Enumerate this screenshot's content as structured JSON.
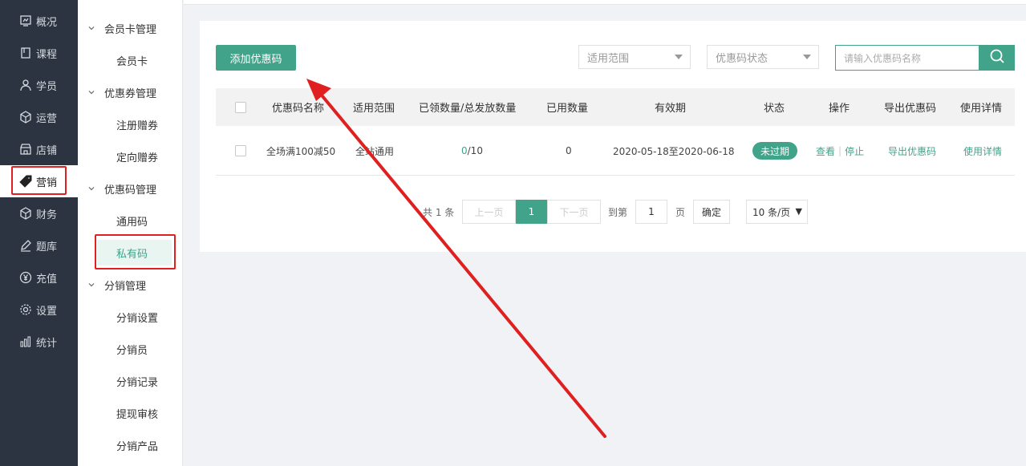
{
  "nav": {
    "items": [
      {
        "label": "概况",
        "icon": "dashboard-icon"
      },
      {
        "label": "课程",
        "icon": "book-icon"
      },
      {
        "label": "学员",
        "icon": "user-icon"
      },
      {
        "label": "运营",
        "icon": "cube-icon"
      },
      {
        "label": "店铺",
        "icon": "store-icon"
      },
      {
        "label": "营销",
        "icon": "tag-icon"
      },
      {
        "label": "财务",
        "icon": "finance-icon"
      },
      {
        "label": "题库",
        "icon": "pencil-icon"
      },
      {
        "label": "充值",
        "icon": "yen-icon"
      },
      {
        "label": "设置",
        "icon": "gear-icon"
      },
      {
        "label": "统计",
        "icon": "bar-chart-icon"
      }
    ],
    "active_index": 5
  },
  "submenu": {
    "group_member": "会员卡管理",
    "item_member_card": "会员卡",
    "group_coupon": "优惠券管理",
    "item_register_coupon": "注册赠券",
    "item_targeted_coupon": "定向赠券",
    "group_promo": "优惠码管理",
    "item_general_code": "通用码",
    "item_private_code": "私有码",
    "group_distribution": "分销管理",
    "item_dist_settings": "分销设置",
    "item_distributor": "分销员",
    "item_dist_record": "分销记录",
    "item_withdraw_review": "提现审核",
    "item_dist_product": "分销产品"
  },
  "toolbar": {
    "add_label": "添加优惠码",
    "scope_placeholder": "适用范围",
    "status_placeholder": "优惠码状态",
    "search_placeholder": "请输入优惠码名称"
  },
  "table": {
    "headers": {
      "name": "优惠码名称",
      "scope": "适用范围",
      "claimed_total": "已领数量/总发放数量",
      "used": "已用数量",
      "validity": "有效期",
      "status": "状态",
      "actions": "操作",
      "export": "导出优惠码",
      "details": "使用详情"
    },
    "rows": [
      {
        "name": "全场满100减50",
        "scope": "全站通用",
        "claimed": "0",
        "total": "/10",
        "used": "0",
        "validity": "2020-05-18至2020-06-18",
        "status": "未过期",
        "view": "查看",
        "stop": "停止",
        "export": "导出优惠码",
        "details": "使用详情"
      }
    ]
  },
  "pagination": {
    "total_text": "共 1 条",
    "prev": "上一页",
    "current": "1",
    "next": "下一页",
    "goto_label": "到第",
    "goto_value": "1",
    "page_unit": "页",
    "confirm": "确定",
    "page_size": "10 条/页"
  },
  "colors": {
    "accent": "#41a38a",
    "nav_bg": "#2b3440",
    "annotation": "#e02020"
  }
}
